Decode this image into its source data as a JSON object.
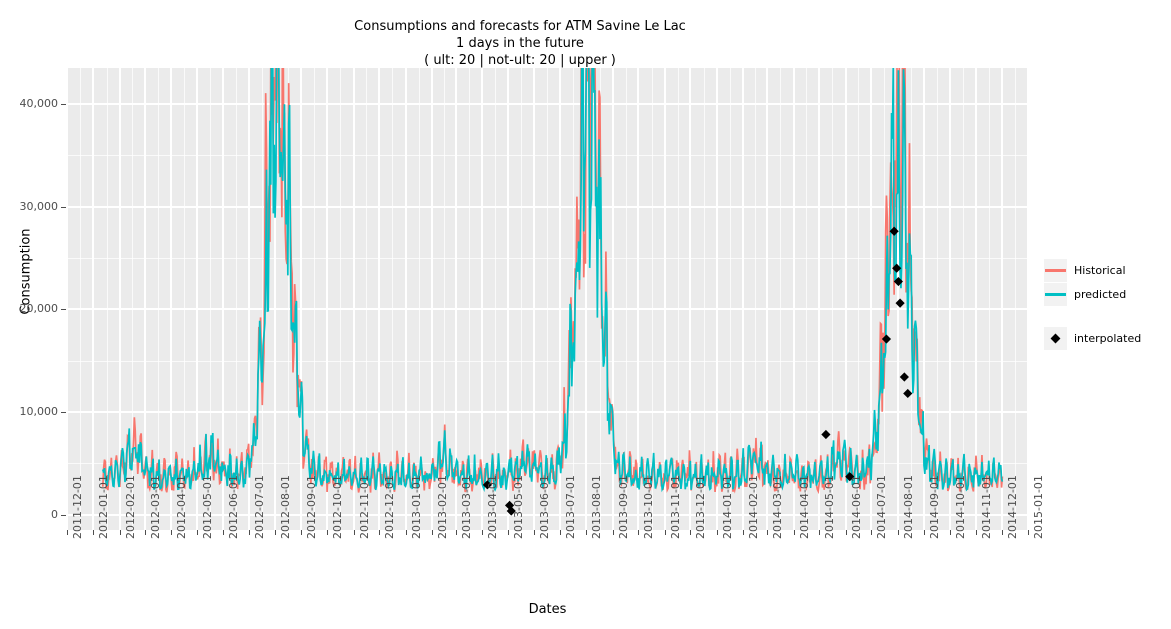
{
  "chart_data": {
    "type": "line",
    "title": "Consumptions and forecasts for ATM Savine Le Lac",
    "subtitle": "1 days in the future",
    "subtitle2": "( ult: 20 | not-ult: 20 | upper )",
    "xlabel": "Dates",
    "ylabel": "Consumption",
    "ylim": [
      -1500,
      43500
    ],
    "xlim": [
      "2011-12-01",
      "2015-01-01"
    ],
    "grid": true,
    "legend_position": "right",
    "y_ticks": [
      0,
      10000,
      20000,
      30000,
      40000
    ],
    "y_tick_labels": [
      "0",
      "10,000",
      "20,000",
      "30,000",
      "40,000"
    ],
    "x_ticks": [
      "2011-12-01",
      "2012-01-01",
      "2012-02-01",
      "2012-03-01",
      "2012-04-01",
      "2012-05-01",
      "2012-06-01",
      "2012-07-01",
      "2012-08-01",
      "2012-09-01",
      "2012-10-01",
      "2012-11-01",
      "2012-12-01",
      "2013-01-01",
      "2013-02-01",
      "2013-03-01",
      "2013-04-01",
      "2013-05-01",
      "2013-06-01",
      "2013-07-01",
      "2013-08-01",
      "2013-09-01",
      "2013-10-01",
      "2013-11-01",
      "2013-12-01",
      "2014-01-01",
      "2014-02-01",
      "2014-03-01",
      "2014-04-01",
      "2014-05-01",
      "2014-06-01",
      "2014-07-01",
      "2014-08-01",
      "2014-09-01",
      "2014-10-01",
      "2014-11-01",
      "2014-12-01",
      "2015-01-01"
    ],
    "series": [
      {
        "name": "Historical",
        "color": "#F8766D",
        "type": "line",
        "description": "Daily observed ATM cash consumption, highly seasonal with large summer peaks (~42,000 in Aug 2012, ~41,500 in Aug 2013, ~39,000 in Aug 2014) and off-season baseline around 2,000-6,000."
      },
      {
        "name": "predicted",
        "color": "#00BFC4",
        "type": "line",
        "description": "One-day-ahead forecast tracking the historical series closely; peaks ~40,000 (2012), ~40,000 (2013), ~34,500 (2014)."
      },
      {
        "name": "interpolated",
        "color": "#000000",
        "type": "point",
        "marker": "diamond",
        "points": [
          {
            "x": "2013-04-07",
            "y": 2900
          },
          {
            "x": "2013-05-03",
            "y": 900
          },
          {
            "x": "2013-05-05",
            "y": 350
          },
          {
            "x": "2014-05-09",
            "y": 7800
          },
          {
            "x": "2014-06-06",
            "y": 3700
          },
          {
            "x": "2014-07-19",
            "y": 17100
          },
          {
            "x": "2014-07-28",
            "y": 27600
          },
          {
            "x": "2014-07-31",
            "y": 24000
          },
          {
            "x": "2014-08-02",
            "y": 22700
          },
          {
            "x": "2014-08-04",
            "y": 20600
          },
          {
            "x": "2014-08-09",
            "y": 13400
          },
          {
            "x": "2014-08-13",
            "y": 11800
          }
        ]
      }
    ]
  },
  "legend": {
    "entries": [
      {
        "label": "Historical",
        "color": "#F8766D",
        "marker": "line"
      },
      {
        "label": "predicted",
        "color": "#00BFC4",
        "marker": "line"
      },
      {
        "label": "interpolated",
        "color": "#000000",
        "marker": "diamond"
      }
    ]
  },
  "colors": {
    "historical": "#F8766D",
    "predicted": "#00BFC4",
    "interpolated": "#000000",
    "panel_background": "#EBEBEB",
    "gridline": "#FFFFFF",
    "axis_text": "#4D4D4D",
    "legend_key_background": "#F2F2F2"
  }
}
